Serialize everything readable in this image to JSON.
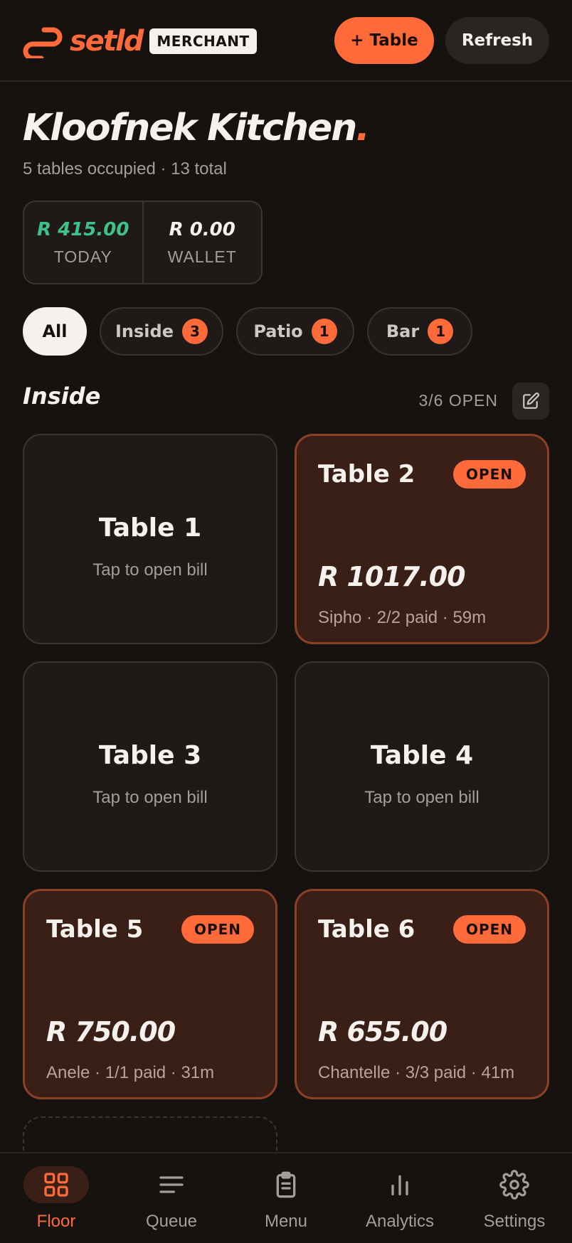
{
  "header": {
    "brand": "setld",
    "badge": "MERCHANT",
    "add_table_label": "+ Table",
    "refresh_label": "Refresh"
  },
  "restaurant": {
    "name": "Kloofnek Kitchen",
    "name_suffix": ".",
    "summary": "5 tables occupied · 13 total"
  },
  "stats": {
    "today_value": "R 415.00",
    "today_label": "TODAY",
    "wallet_value": "R 0.00",
    "wallet_label": "WALLET"
  },
  "filters": [
    {
      "label": "All",
      "count": null,
      "active": true
    },
    {
      "label": "Inside",
      "count": "3",
      "active": false
    },
    {
      "label": "Patio",
      "count": "1",
      "active": false
    },
    {
      "label": "Bar",
      "count": "1",
      "active": false
    }
  ],
  "section": {
    "title": "Inside",
    "open_count": "3/6 OPEN"
  },
  "tables": [
    {
      "name": "Table 1",
      "status": "empty",
      "hint": "Tap to open bill"
    },
    {
      "name": "Table 2",
      "status": "open",
      "badge": "OPEN",
      "amount": "R 1017.00",
      "meta": "Sipho · 2/2 paid · 59m"
    },
    {
      "name": "Table 3",
      "status": "empty",
      "hint": "Tap to open bill"
    },
    {
      "name": "Table 4",
      "status": "empty",
      "hint": "Tap to open bill"
    },
    {
      "name": "Table 5",
      "status": "open",
      "badge": "OPEN",
      "amount": "R 750.00",
      "meta": "Anele · 1/1 paid · 31m"
    },
    {
      "name": "Table 6",
      "status": "open",
      "badge": "OPEN",
      "amount": "R 655.00",
      "meta": "Chantelle · 3/3 paid · 41m"
    }
  ],
  "nav": [
    {
      "label": "Floor",
      "icon": "grid-icon",
      "active": true
    },
    {
      "label": "Queue",
      "icon": "list-icon",
      "active": false
    },
    {
      "label": "Menu",
      "icon": "clipboard-icon",
      "active": false
    },
    {
      "label": "Analytics",
      "icon": "bar-chart-icon",
      "active": false
    },
    {
      "label": "Settings",
      "icon": "gear-icon",
      "active": false
    }
  ],
  "colors": {
    "accent": "#ff6a3a",
    "background": "#161210",
    "money_green": "#3fc28a"
  }
}
